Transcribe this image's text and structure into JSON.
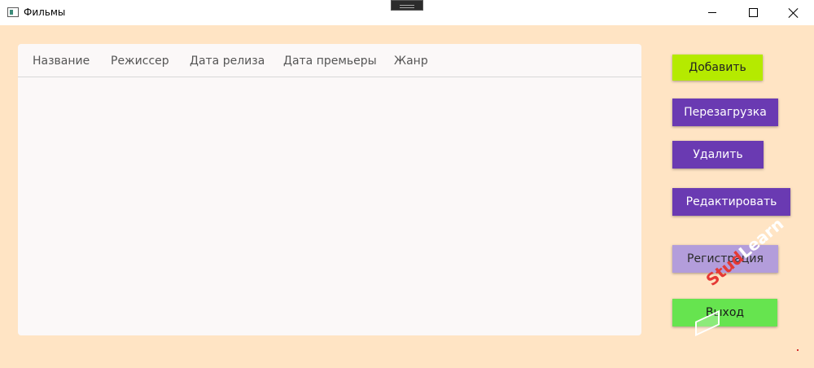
{
  "window": {
    "title": "Фильмы"
  },
  "table": {
    "columns": [
      "Название",
      "Режиссер",
      "Дата релиза",
      "Дата премьеры",
      "Жанр"
    ]
  },
  "buttons": {
    "add": "Добавить",
    "reload": "Перезагрузка",
    "delete": "Удалить",
    "edit": "Редактировать",
    "register": "Регистрация",
    "exit": "Выход"
  },
  "watermark": {
    "part1": "Stud",
    "part2": "Learn"
  },
  "colors": {
    "background": "#ffe4c4",
    "add_button": "#b5ea00",
    "primary_button": "#6a3ab2",
    "register_button": "#b39ddb",
    "exit_button": "#66e44f"
  }
}
